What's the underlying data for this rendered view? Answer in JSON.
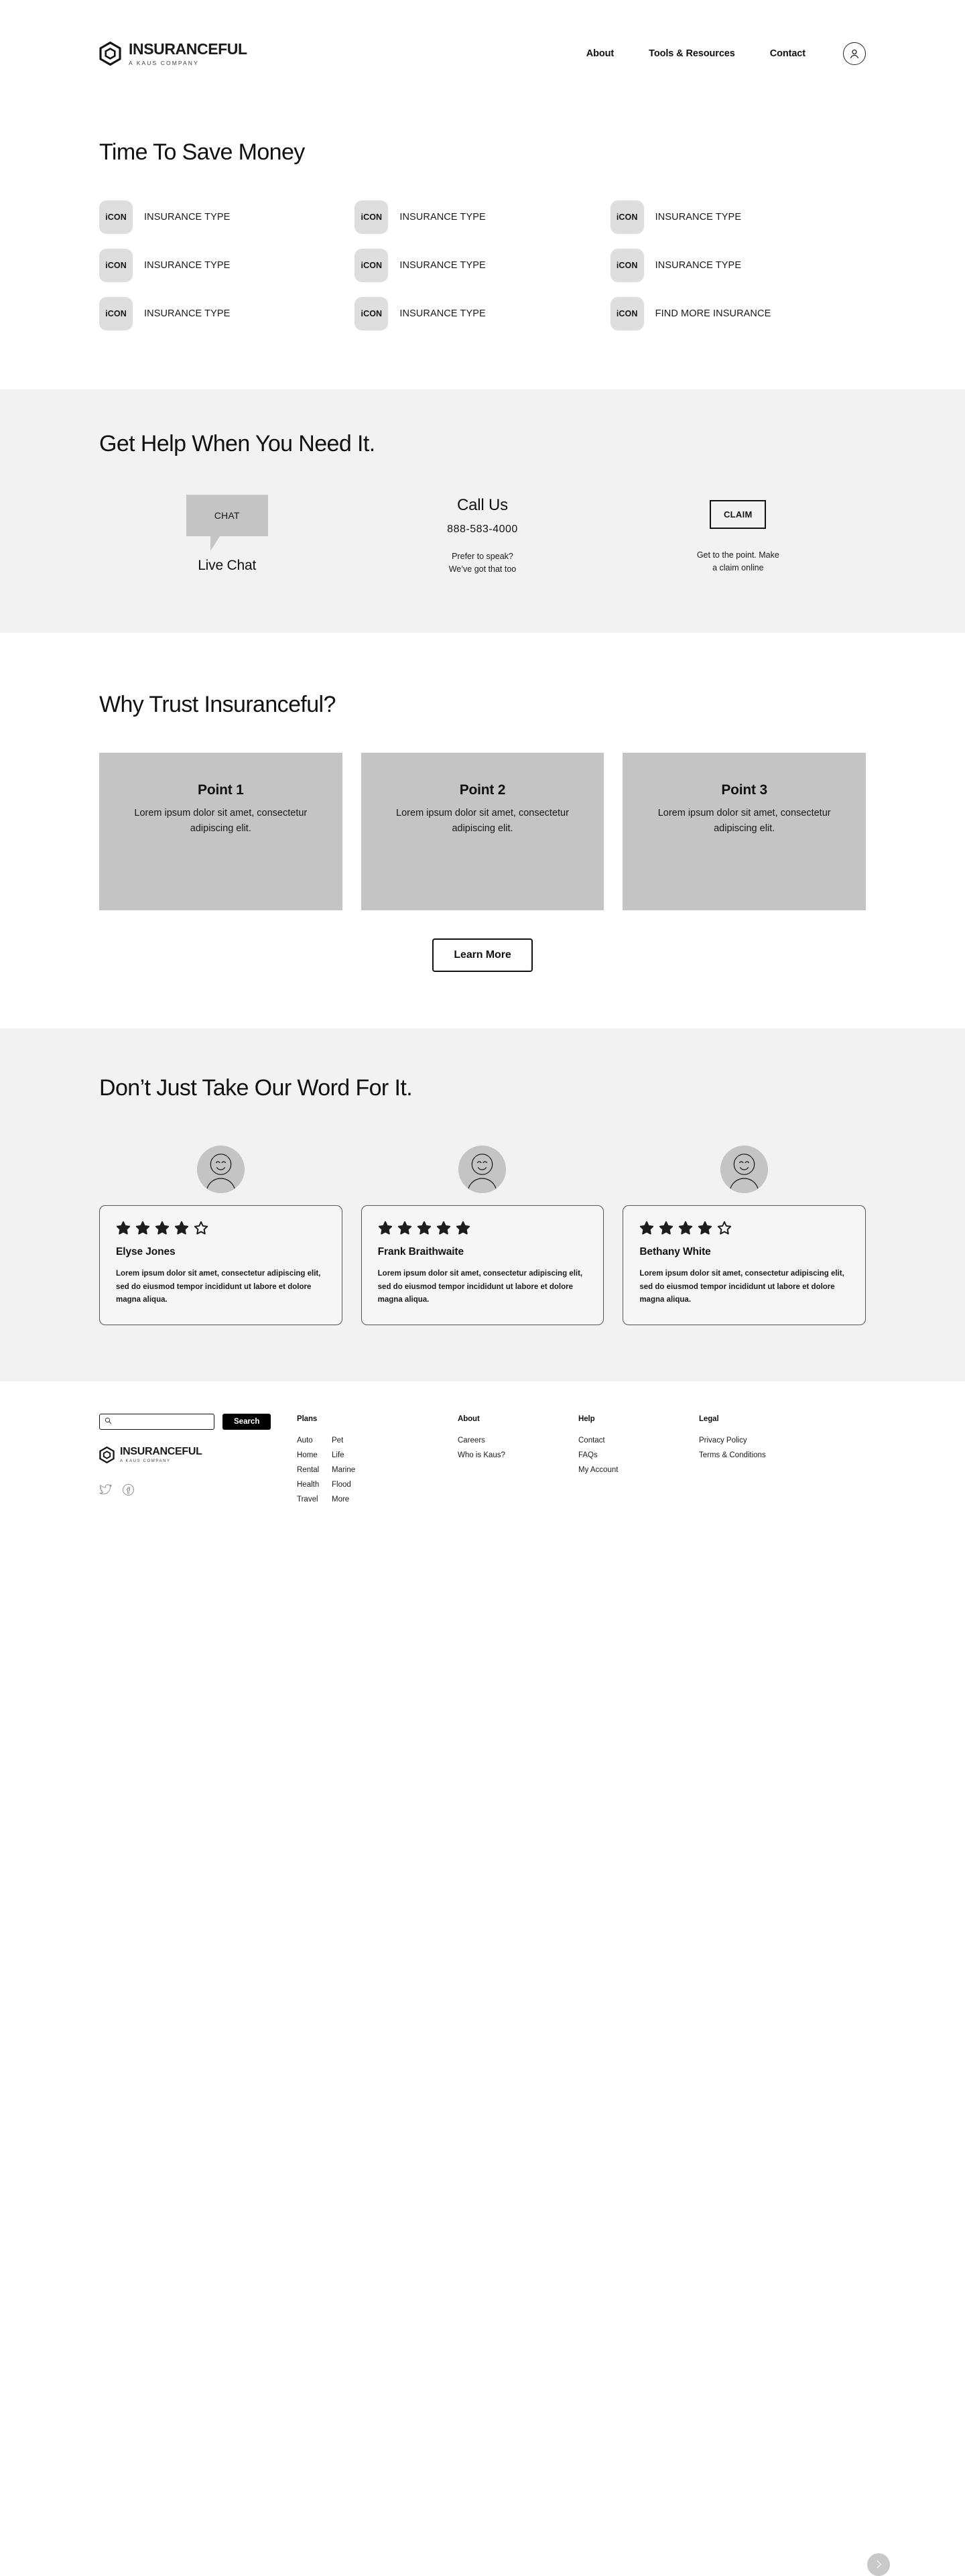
{
  "brand": {
    "name": "INSURANCEFUL",
    "tagline": "A KAUS COMPANY",
    "mark_icon": "hexagon-logo-icon"
  },
  "header": {
    "nav": [
      {
        "label": "About"
      },
      {
        "label": "Tools & Resources"
      },
      {
        "label": "Contact"
      }
    ],
    "account_icon": "user-account-icon"
  },
  "insurance_section": {
    "title": "Time To Save Money",
    "items": [
      {
        "icon_label": "iCON",
        "label": "INSURANCE TYPE"
      },
      {
        "icon_label": "iCON",
        "label": "INSURANCE TYPE"
      },
      {
        "icon_label": "iCON",
        "label": "INSURANCE TYPE"
      },
      {
        "icon_label": "iCON",
        "label": "INSURANCE TYPE"
      },
      {
        "icon_label": "iCON",
        "label": "INSURANCE TYPE"
      },
      {
        "icon_label": "iCON",
        "label": "INSURANCE TYPE"
      },
      {
        "icon_label": "iCON",
        "label": "INSURANCE TYPE"
      },
      {
        "icon_label": "iCON",
        "label": "INSURANCE TYPE"
      },
      {
        "icon_label": "iCON",
        "label": "FIND MORE INSURANCE"
      }
    ]
  },
  "help_section": {
    "title": "Get Help When You Need It.",
    "chat": {
      "bubble_label": "CHAT",
      "caption": "Live Chat"
    },
    "call": {
      "title": "Call Us",
      "number": "888-583-4000",
      "sub_line1": "Prefer to speak?",
      "sub_line2": "We’ve got that too"
    },
    "claim": {
      "button_label": "CLAIM",
      "sub_line1": "Get to the point. Make",
      "sub_line2": "a claim online"
    }
  },
  "trust_section": {
    "title": "Why Trust Insuranceful?",
    "cards": [
      {
        "title": "Point 1",
        "body": "Lorem ipsum dolor sit amet, consectetur adipiscing elit."
      },
      {
        "title": "Point 2",
        "body": "Lorem ipsum dolor sit amet, consectetur adipiscing elit."
      },
      {
        "title": "Point 3",
        "body": "Lorem ipsum dolor sit amet, consectetur adipiscing elit."
      }
    ],
    "learn_more_label": "Learn More"
  },
  "testimonials_section": {
    "title": "Don’t Just Take Our Word For It.",
    "next_icon": "chevron-right-icon",
    "max_stars": 5,
    "cards": [
      {
        "name": "Elyse Jones",
        "rating": 4,
        "body": "Lorem ipsum dolor sit amet, consectetur adipiscing elit, sed do eiusmod tempor incididunt ut labore et dolore magna aliqua.",
        "avatar_icon": "smiley-avatar-icon"
      },
      {
        "name": "Frank Braithwaite",
        "rating": 5,
        "body": "Lorem ipsum dolor sit amet, consectetur adipiscing elit, sed do eiusmod tempor incididunt ut labore et dolore magna aliqua.",
        "avatar_icon": "smiley-avatar-icon"
      },
      {
        "name": "Bethany White",
        "rating": 4,
        "body": "Lorem ipsum dolor sit amet, consectetur adipiscing elit, sed do eiusmod tempor incididunt ut labore et dolore magna aliqua.",
        "avatar_icon": "smiley-avatar-icon"
      }
    ]
  },
  "footer": {
    "search": {
      "placeholder": "",
      "value": "",
      "icon": "search-icon",
      "button_label": "Search"
    },
    "socials": [
      {
        "icon": "twitter-icon"
      },
      {
        "icon": "facebook-icon"
      }
    ],
    "columns": {
      "plans": {
        "head": "Plans",
        "col_a": [
          "Auto",
          "Home",
          "Rental",
          "Health",
          "Travel"
        ],
        "col_b": [
          "Pet",
          "Life",
          "Marine",
          "Flood",
          "More"
        ]
      },
      "about": {
        "head": "About",
        "links": [
          "Careers",
          "Who is Kaus?"
        ]
      },
      "help": {
        "head": "Help",
        "links": [
          "Contact",
          "FAQs",
          "My Account"
        ]
      },
      "legal": {
        "head": "Legal",
        "links": [
          "Privacy Policy",
          "Terms & Conditions"
        ]
      }
    }
  },
  "colors": {
    "page_bg": "#ffffff",
    "section_gray": "#f2f2f2",
    "card_gray": "#c4c4c4",
    "icon_gray": "#dedede",
    "text": "#111111",
    "accent_black": "#000000"
  }
}
